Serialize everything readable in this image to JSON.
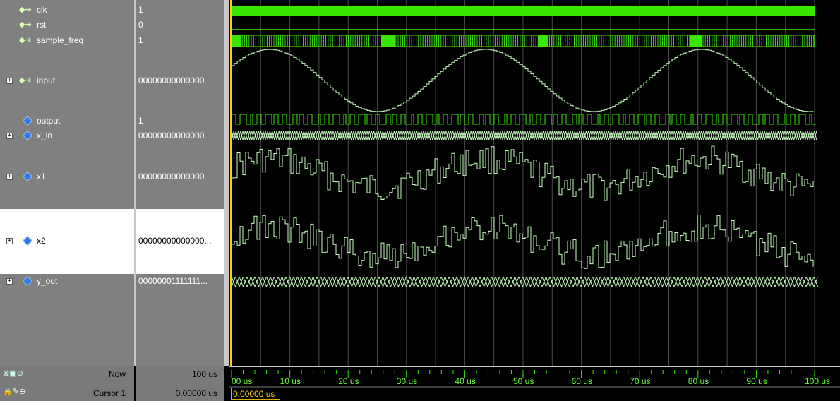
{
  "signals": [
    {
      "name": "clk",
      "value": "1",
      "icon": "input-arrow",
      "expandable": false
    },
    {
      "name": "rst",
      "value": "0",
      "icon": "input-arrow",
      "expandable": false
    },
    {
      "name": "sample_freq",
      "value": "1",
      "icon": "input-arrow",
      "expandable": false
    },
    {
      "name": "input",
      "value": "00000000000000...",
      "icon": "input-arrow",
      "expandable": true
    },
    {
      "name": "output",
      "value": "1",
      "icon": "output-diamond",
      "expandable": false
    },
    {
      "name": "x_in",
      "value": "00000000000000...",
      "icon": "diamond",
      "expandable": true
    },
    {
      "name": "x1",
      "value": "00000000000000...",
      "icon": "diamond",
      "expandable": true
    },
    {
      "name": "x2",
      "value": "00000000000000...",
      "icon": "diamond",
      "expandable": true
    },
    {
      "name": "y_out",
      "value": "00000001111111...",
      "icon": "diamond",
      "expandable": true
    }
  ],
  "status": {
    "now_label": "Now",
    "now_value": "100 us",
    "cursor_label": "Cursor 1",
    "cursor_value": "0.00000 us",
    "cursor_marker": "0.00000 us"
  },
  "timeline": {
    "unit": "us",
    "ticks": [
      "00 us",
      "10 us",
      "20 us",
      "30 us",
      "40 us",
      "50 us",
      "60 us",
      "70 us",
      "80 us",
      "90 us",
      "100 us"
    ]
  },
  "colors": {
    "wave": "#39e600",
    "analog": "#c8ffc0",
    "grid": "#4a4a4a",
    "cursor": "#ffd000",
    "panel": "#808080"
  }
}
